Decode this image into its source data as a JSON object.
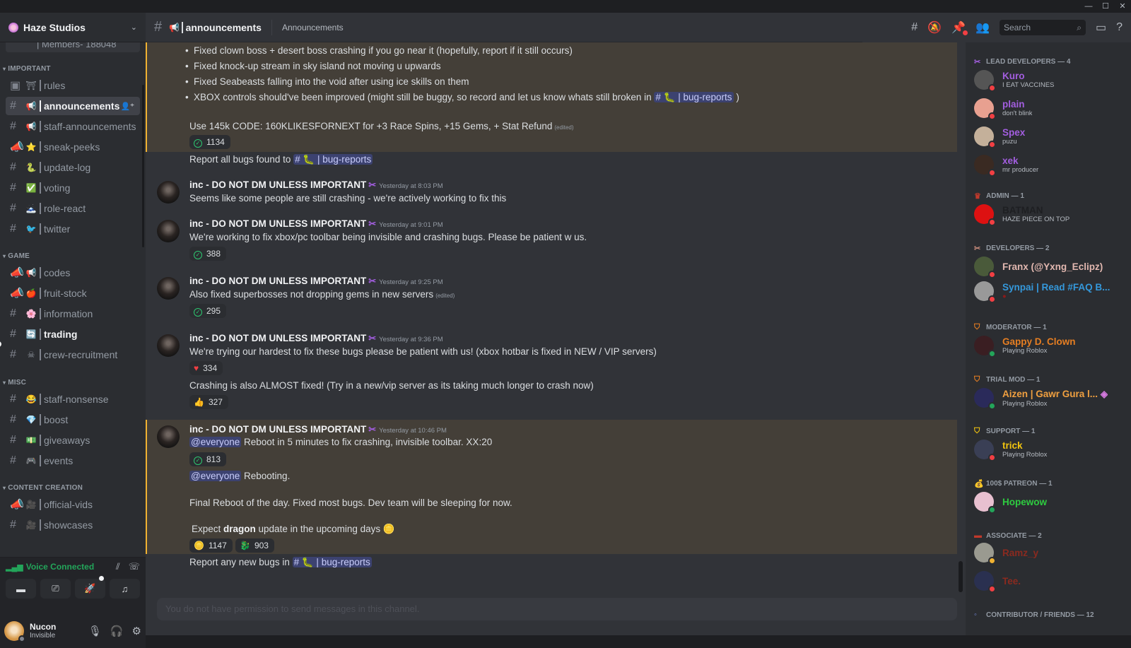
{
  "window": {
    "controls": [
      "minimize",
      "maximize",
      "close"
    ]
  },
  "server": {
    "name": "Haze Studios"
  },
  "sidebar": {
    "cut_item": "| Members- 188048",
    "categories": [
      {
        "name": "IMPORTANT"
      },
      {
        "name": "GAME"
      },
      {
        "name": "MISC"
      },
      {
        "name": "CONTENT CREATION"
      }
    ],
    "channels": [
      {
        "name": "rules",
        "emoji": "⛩",
        "type": "rules"
      },
      {
        "name": "announcements",
        "emoji": "📢",
        "type": "text",
        "active": true
      },
      {
        "name": "staff-announcements",
        "emoji": "📢",
        "type": "text"
      },
      {
        "name": "sneak-peeks",
        "emoji": "⭐",
        "type": "announcement"
      },
      {
        "name": "update-log",
        "emoji": "🐍",
        "type": "text"
      },
      {
        "name": "voting",
        "emoji": "✅",
        "type": "text"
      },
      {
        "name": "role-react",
        "emoji": "🗻",
        "type": "text"
      },
      {
        "name": "twitter",
        "emoji": "🐦",
        "type": "text"
      },
      {
        "name": "codes",
        "emoji": "📢",
        "type": "announcement"
      },
      {
        "name": "fruit-stock",
        "emoji": "🍎",
        "type": "announcement"
      },
      {
        "name": "information",
        "emoji": "🌸",
        "type": "text"
      },
      {
        "name": "trading",
        "emoji": "🔄",
        "type": "text",
        "unread": true
      },
      {
        "name": "crew-recruitment",
        "emoji": "☠",
        "type": "text"
      },
      {
        "name": "staff-nonsense",
        "emoji": "😂",
        "type": "text"
      },
      {
        "name": "boost",
        "emoji": "💎",
        "type": "text"
      },
      {
        "name": "giveaways",
        "emoji": "💵",
        "type": "text"
      },
      {
        "name": "events",
        "emoji": "🎮",
        "type": "text"
      },
      {
        "name": "official-vids",
        "emoji": "🎥",
        "type": "announcement"
      },
      {
        "name": "showcases",
        "emoji": "🎥",
        "type": "text"
      }
    ],
    "voice": {
      "status": "Voice Connected"
    },
    "user": {
      "name": "Nucon",
      "status": "Invisible"
    }
  },
  "header": {
    "channel": "announcements",
    "emoji": "📢",
    "topic": "Announcements",
    "search_placeholder": "Search"
  },
  "messages": {
    "bullets": [
      "Fixed clown boss + desert boss crashing if you go near it (hopefully, report if it still occurs)",
      "Fixed knock-up stream in sky island not moving u upwards",
      "Fixed Seabeasts falling into the void after using ice skills on them",
      "XBOX controls should've been improved (might still be buggy, so record and let us know whats still broken in"
    ],
    "bullet_tail": ")",
    "code_line": "Use 145k CODE: 160KLIKESFORNEXT for +3 Race Spins, +15 Gems, + Stat Refund",
    "edited": "(edited)",
    "channel_mention": "bug-reports",
    "reaction_1134": "1134",
    "report_all": "Report all bugs found to",
    "author": "inc - DO NOT DM UNLESS IMPORTANT",
    "posts": [
      {
        "time": "Yesterday at 8:03 PM",
        "text": "Seems like some people are still crashing  - we're actively working to fix this"
      },
      {
        "time": "Yesterday at 9:01 PM",
        "text": "We're working to fix xbox/pc toolbar being invisible and crashing bugs. Please be patient w us.",
        "reaction": "388"
      },
      {
        "time": "Yesterday at 9:25 PM",
        "text": "Also fixed superbosses not dropping gems in new servers",
        "reaction": "295"
      },
      {
        "time": "Yesterday at 9:36 PM",
        "text": "We're trying our hardest to fix these bugs please be patient with us! (xbox hotbar is fixed in NEW / VIP servers)",
        "reaction": "334",
        "text2": "Crashing is also ALMOST fixed! (Try in a new/vip server as its taking much longer to crash now)",
        "reaction2": "327"
      },
      {
        "time": "Yesterday at 10:46 PM",
        "mention": "@everyone",
        "text": "Reboot in 5 minutes to fix crashing, invisible toolbar. XX:20",
        "reaction": "813",
        "text2": "Rebooting.",
        "text3": "Final Reboot of the day. Fixed most bugs. Dev team will be sleeping for now.",
        "text4a": "Expect ",
        "text4b": "dragon",
        "text4c": " update in the upcoming days",
        "reaction_a": "1147",
        "reaction_b": "903"
      }
    ],
    "report_new": "Report any new bugs in"
  },
  "composer": {
    "placeholder": "You do not have permission to send messages in this channel."
  },
  "members": {
    "groups": [
      {
        "label": "LEAD DEVELOPERS — 4",
        "color": "#a35ee0"
      },
      {
        "label": "ADMIN — 1",
        "color": "#c0392b"
      },
      {
        "label": "DEVELOPERS — 2",
        "color": "#c78b7b"
      },
      {
        "label": "MODERATOR — 1",
        "color": "#e67e22"
      },
      {
        "label": "TRIAL MOD — 1",
        "color": "#e67e22"
      },
      {
        "label": "SUPPORT — 1",
        "color": "#f1c40f"
      },
      {
        "label": "100$ PATREON — 1",
        "color": "#f1c40f"
      },
      {
        "label": "ASSOCIATE — 2",
        "color": "#c0392b"
      },
      {
        "label": "CONTRIBUTOR / FRIENDS — 12",
        "color": "#7289da"
      }
    ],
    "list": [
      {
        "name": "Kuro",
        "status": "I EAT VACCINES",
        "color": "#a35ee0"
      },
      {
        "name": "plain",
        "status": "don't blink",
        "color": "#a35ee0"
      },
      {
        "name": "Spex",
        "status": "puzu",
        "color": "#a35ee0"
      },
      {
        "name": "xek",
        "status": "mr producer",
        "color": "#a35ee0"
      },
      {
        "name": "BATMAN",
        "status": "HAZE PIECE ON TOP",
        "color": "#1e1f22"
      },
      {
        "name": "Franx (@Yxng_Eclipz)",
        "status": "",
        "color": "#e2b8b0"
      },
      {
        "name": "Synpai | Read #FAQ B...",
        "status": "",
        "color": "#3498db"
      },
      {
        "name": "Gappy D. Clown",
        "status": "Playing Roblox",
        "color": "#e67e22"
      },
      {
        "name": "Aizen | Gawr Gura l...",
        "status": "Playing Roblox",
        "color": "#f0a040"
      },
      {
        "name": "trick",
        "status": "Playing Roblox",
        "color": "#f1c40f"
      },
      {
        "name": "Hopewow",
        "status": "",
        "color": "#2ecc40"
      },
      {
        "name": "Ramz_y",
        "status": "",
        "color": "#8b2a1f"
      },
      {
        "name": "Tee.",
        "status": "",
        "color": "#8b2a1f"
      }
    ]
  }
}
